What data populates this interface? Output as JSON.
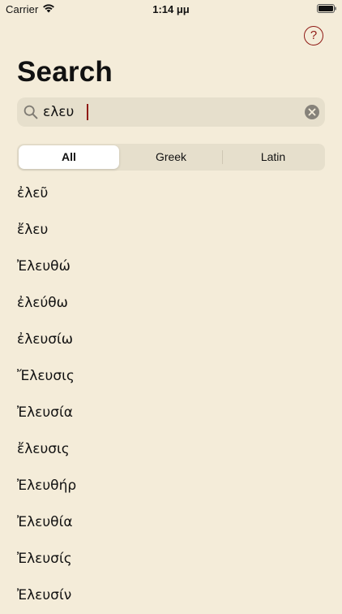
{
  "status_bar": {
    "carrier": "Carrier",
    "time": "1:14 μμ"
  },
  "header": {
    "title": "Search",
    "help_label": "?"
  },
  "search": {
    "value": "ελευ"
  },
  "filter": {
    "segments": [
      "All",
      "Greek",
      "Latin"
    ],
    "selected": "All"
  },
  "results": [
    "ἐλεῦ",
    "ἔλευ",
    "Ἐλευθώ",
    "ἐλεύθω",
    "ἐλευσίω",
    "Ἔλευσις",
    "Ἐλευσία",
    "ἔλευσις",
    "Ἐλευθήρ",
    "Ἐλευθία",
    "Ἐλευσίς",
    "Ἐλευσίν"
  ],
  "colors": {
    "background": "#f4ecd9",
    "field_background": "#e6dfcc",
    "accent": "#8f1a15"
  }
}
